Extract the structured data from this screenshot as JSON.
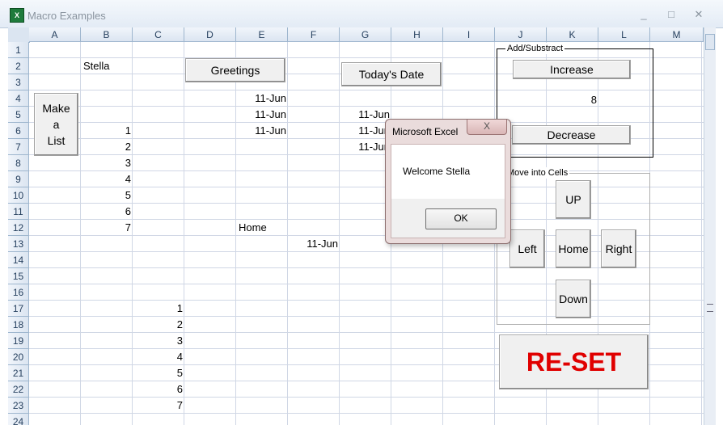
{
  "window": {
    "title": "Macro Examples",
    "icon": "excel-icon",
    "minimize": "_",
    "maximize": "□",
    "close": "✕"
  },
  "columns": [
    "A",
    "B",
    "C",
    "D",
    "E",
    "F",
    "G",
    "H",
    "I",
    "J",
    "K",
    "L",
    "M"
  ],
  "rows": [
    "1",
    "2",
    "3",
    "4",
    "5",
    "6",
    "7",
    "8",
    "9",
    "10",
    "11",
    "12",
    "13",
    "14",
    "15",
    "16",
    "17",
    "18",
    "19",
    "20",
    "21",
    "22",
    "23",
    "24"
  ],
  "cells": {
    "B2": "Stella",
    "E4": "11-Jun",
    "E5": "11-Jun",
    "E6": "11-Jun",
    "G5": "11-Jun",
    "G6": "11-Jun",
    "G7": "11-Jun",
    "B6": "1",
    "B7": "2",
    "B8": "3",
    "B9": "4",
    "B10": "5",
    "B11": "6",
    "B12": "7",
    "E12": "Home",
    "F13": "11-Jun",
    "C17": "1",
    "C18": "2",
    "C19": "3",
    "C20": "4",
    "C21": "5",
    "C22": "6",
    "C23": "7",
    "K5": "8"
  },
  "buttons": {
    "greetings": "Greetings",
    "todays_date": "Today's Date",
    "make_list_1": "Make",
    "make_list_2": "a",
    "make_list_3": "List",
    "increase": "Increase",
    "decrease": "Decrease",
    "up": "UP",
    "left": "Left",
    "home": "Home",
    "right": "Right",
    "down": "Down",
    "reset": "RE-SET"
  },
  "groups": {
    "add_subtract": "Add/Substract",
    "move_into_cells": "Move into Cells"
  },
  "dialog": {
    "title": "Microsoft Excel",
    "close": "X",
    "message": "Welcome Stella",
    "ok": "OK"
  },
  "colors": {
    "reset_text": "#e00000",
    "header_bg": "#dbe5f1",
    "gridline": "#d0d7e5",
    "dialog_bg": "#eadcdc"
  }
}
